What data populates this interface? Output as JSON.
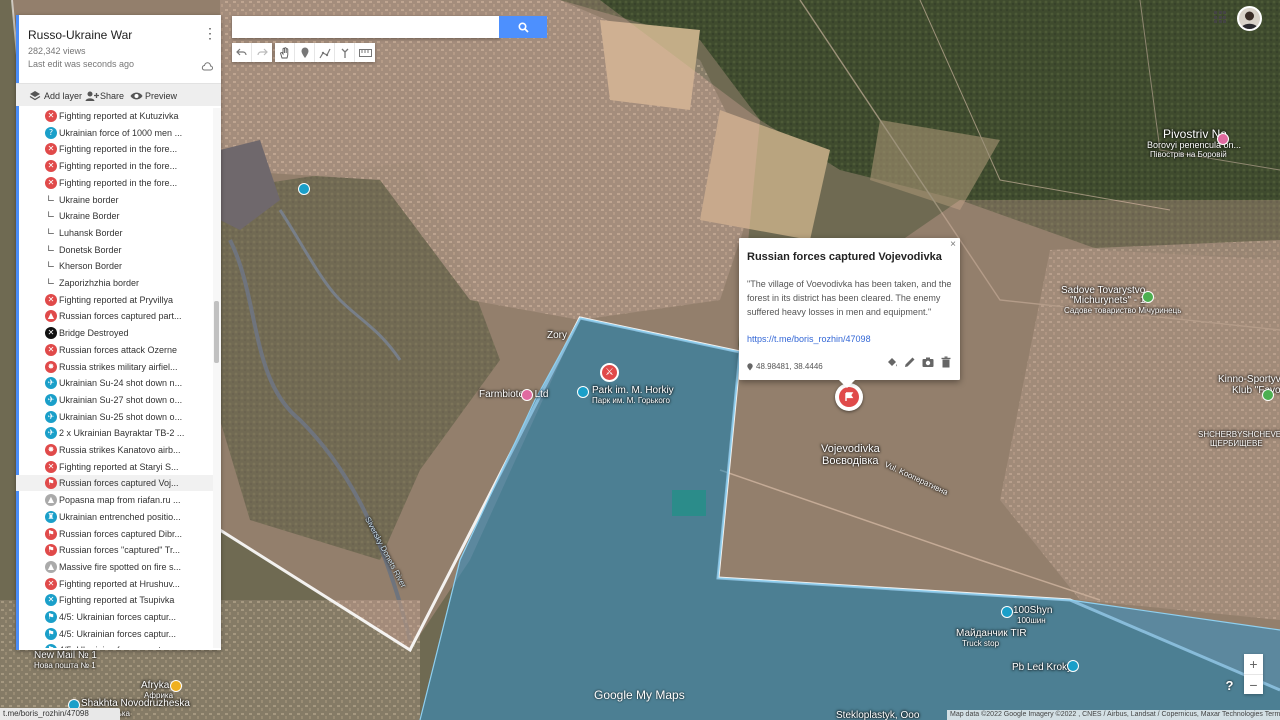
{
  "map": {
    "title": "Russo-Ukraine War",
    "views": "282,342 views",
    "last_edit": "Last edit was seconds ago"
  },
  "toolbar": {
    "add_layer": "Add layer",
    "share": "Share",
    "preview": "Preview"
  },
  "layers": [
    {
      "label": "Fighting reported at Kutuzivka",
      "icon": "fight",
      "color": "#e04a4a"
    },
    {
      "label": "Ukrainian force of 1000 men ...",
      "icon": "question",
      "color": "#1a9fc9"
    },
    {
      "label": "Fighting reported in the fore...",
      "icon": "fight",
      "color": "#e04a4a"
    },
    {
      "label": "Fighting reported in the fore...",
      "icon": "fight",
      "color": "#e04a4a"
    },
    {
      "label": "Fighting reported in the fore...",
      "icon": "fight",
      "color": "#e04a4a"
    },
    {
      "label": "Ukraine border",
      "icon": "line",
      "color": "#666666"
    },
    {
      "label": "Ukraine Border",
      "icon": "line",
      "color": "#666666"
    },
    {
      "label": "Luhansk Border",
      "icon": "line",
      "color": "#666666"
    },
    {
      "label": "Donetsk Border",
      "icon": "line",
      "color": "#666666"
    },
    {
      "label": "Kherson Border",
      "icon": "line",
      "color": "#666666"
    },
    {
      "label": "Zaporizhzhia border",
      "icon": "line",
      "color": "#666666"
    },
    {
      "label": "Fighting reported at Pryvillya",
      "icon": "fight",
      "color": "#e04a4a"
    },
    {
      "label": "Russian forces captured part...",
      "icon": "warning",
      "color": "#e04a4a"
    },
    {
      "label": "Bridge Destroyed",
      "icon": "cross",
      "color": "#111111"
    },
    {
      "label": "Russian forces attack Ozerne",
      "icon": "fight",
      "color": "#e04a4a"
    },
    {
      "label": "Russia strikes military airfiel...",
      "icon": "burst",
      "color": "#e04a4a"
    },
    {
      "label": "Ukrainian Su-24 shot down n...",
      "icon": "plane",
      "color": "#1a9fc9"
    },
    {
      "label": "Ukrainian Su-27 shot down o...",
      "icon": "plane",
      "color": "#1a9fc9"
    },
    {
      "label": "Ukrainian Su-25 shot down o...",
      "icon": "plane",
      "color": "#1a9fc9"
    },
    {
      "label": "2 x Ukrainian Bayraktar TB-2 ...",
      "icon": "drone",
      "color": "#1a9fc9"
    },
    {
      "label": "Russia strikes Kanatovo airb...",
      "icon": "burst",
      "color": "#e04a4a"
    },
    {
      "label": "Fighting reported at Staryi S...",
      "icon": "fight",
      "color": "#e04a4a"
    },
    {
      "label": "Russian forces captured Voj...",
      "icon": "flag",
      "color": "#e04a4a",
      "selected": true
    },
    {
      "label": "Popasna map from rіafan.ru ...",
      "icon": "warning",
      "color": "#aaaaaa"
    },
    {
      "label": "Ukrainian entrenched positio...",
      "icon": "castle",
      "color": "#1a9fc9"
    },
    {
      "label": "Russian forces captured Dibr...",
      "icon": "flag",
      "color": "#e04a4a"
    },
    {
      "label": "Russian forces \"captured\" Tr...",
      "icon": "flag",
      "color": "#e04a4a"
    },
    {
      "label": "Massive fire spotted on fire s...",
      "icon": "warning",
      "color": "#aaaaaa"
    },
    {
      "label": "Fighting reported at Hrushuv...",
      "icon": "fight",
      "color": "#e04a4a"
    },
    {
      "label": "Fighting reported at Tsupivka",
      "icon": "fight",
      "color": "#1a9fc9"
    },
    {
      "label": "4/5: Ukrainian forces captur...",
      "icon": "flag",
      "color": "#1a9fc9"
    },
    {
      "label": "4/5: Ukrainian forces captur...",
      "icon": "flag",
      "color": "#1a9fc9"
    },
    {
      "label": "4/5: Ukrainian forces captur...",
      "icon": "flag",
      "color": "#1a9fc9"
    }
  ],
  "search": {
    "placeholder": ""
  },
  "popup": {
    "title": "Russian forces captured Vojevodivka",
    "body": "\"The village of Voevodivka has been taken, and the forest in its district has been cleared. The enemy suffered heavy losses in men and equipment.\"",
    "link": "https://t.me/boris_rozhin/47098",
    "coords": "48.98481, 38.4446",
    "close": "×"
  },
  "map_labels": {
    "pivostriv": "Pivostriv Na",
    "borovyi": "Borovyi penencula on...",
    "borovyi_ru": "Півострів на Боровій",
    "sadove": "Sadove Tovarystvo",
    "michurynets": "\"Michurynets\" - 1",
    "michurynets_ru": "Садове товариство Мічуринець",
    "kinno": "Kinno-Sportyvn",
    "klub": "Klub \"Favor\"",
    "shcherbyshcheve": "SHCHERBYSHCHEVE",
    "shcherbyshcheve_ua": "ЩЕРБИЩЕВЕ",
    "vojevodivka": "Vojevodivka",
    "vojevodivka_ua": "Воєводівка",
    "park": "Park im. M. Horkiy",
    "park_ru": "Парк им. М. Горького",
    "zory": "Zory",
    "farmbiotest": "Farmbiotest Ltd",
    "new_mail": "New Mail № 1",
    "new_mail_ua": "Нова пошта № 1",
    "afryka": "Afryka",
    "afryka_ua": "Африка",
    "shakhta": "Shakhta Novodruzheska",
    "shakhta_ua": "Дружеська",
    "tooshyn": "100Shyn",
    "tooshyn_ua": "100шин",
    "maidanchyk": "Майданчик TIR",
    "truck_stop": "Truck stop",
    "pb_led": "Pb Led Kroky",
    "steklo": "Steklоplastyk, Ooo",
    "river": "Siversky Donets River",
    "vul": "Vul. Kооперативна"
  },
  "logo": "Google My Maps",
  "attribution": "Map data ©2022 Google Imagery ©2022 , CNES / Airbus, Landsat / Copernicus, Maxar Technologies   Terms",
  "status_url": "t.me/boris_rozhin/47098",
  "zoom": {
    "plus": "+",
    "minus": "−"
  },
  "help": "?",
  "colors": {
    "accent": "#4a8df8",
    "fight_red": "#e04a4a",
    "ukraine_blue": "#1a9fc9",
    "territory_blue": "#2f8fc8",
    "territory_pink": "#f2b8b0"
  }
}
